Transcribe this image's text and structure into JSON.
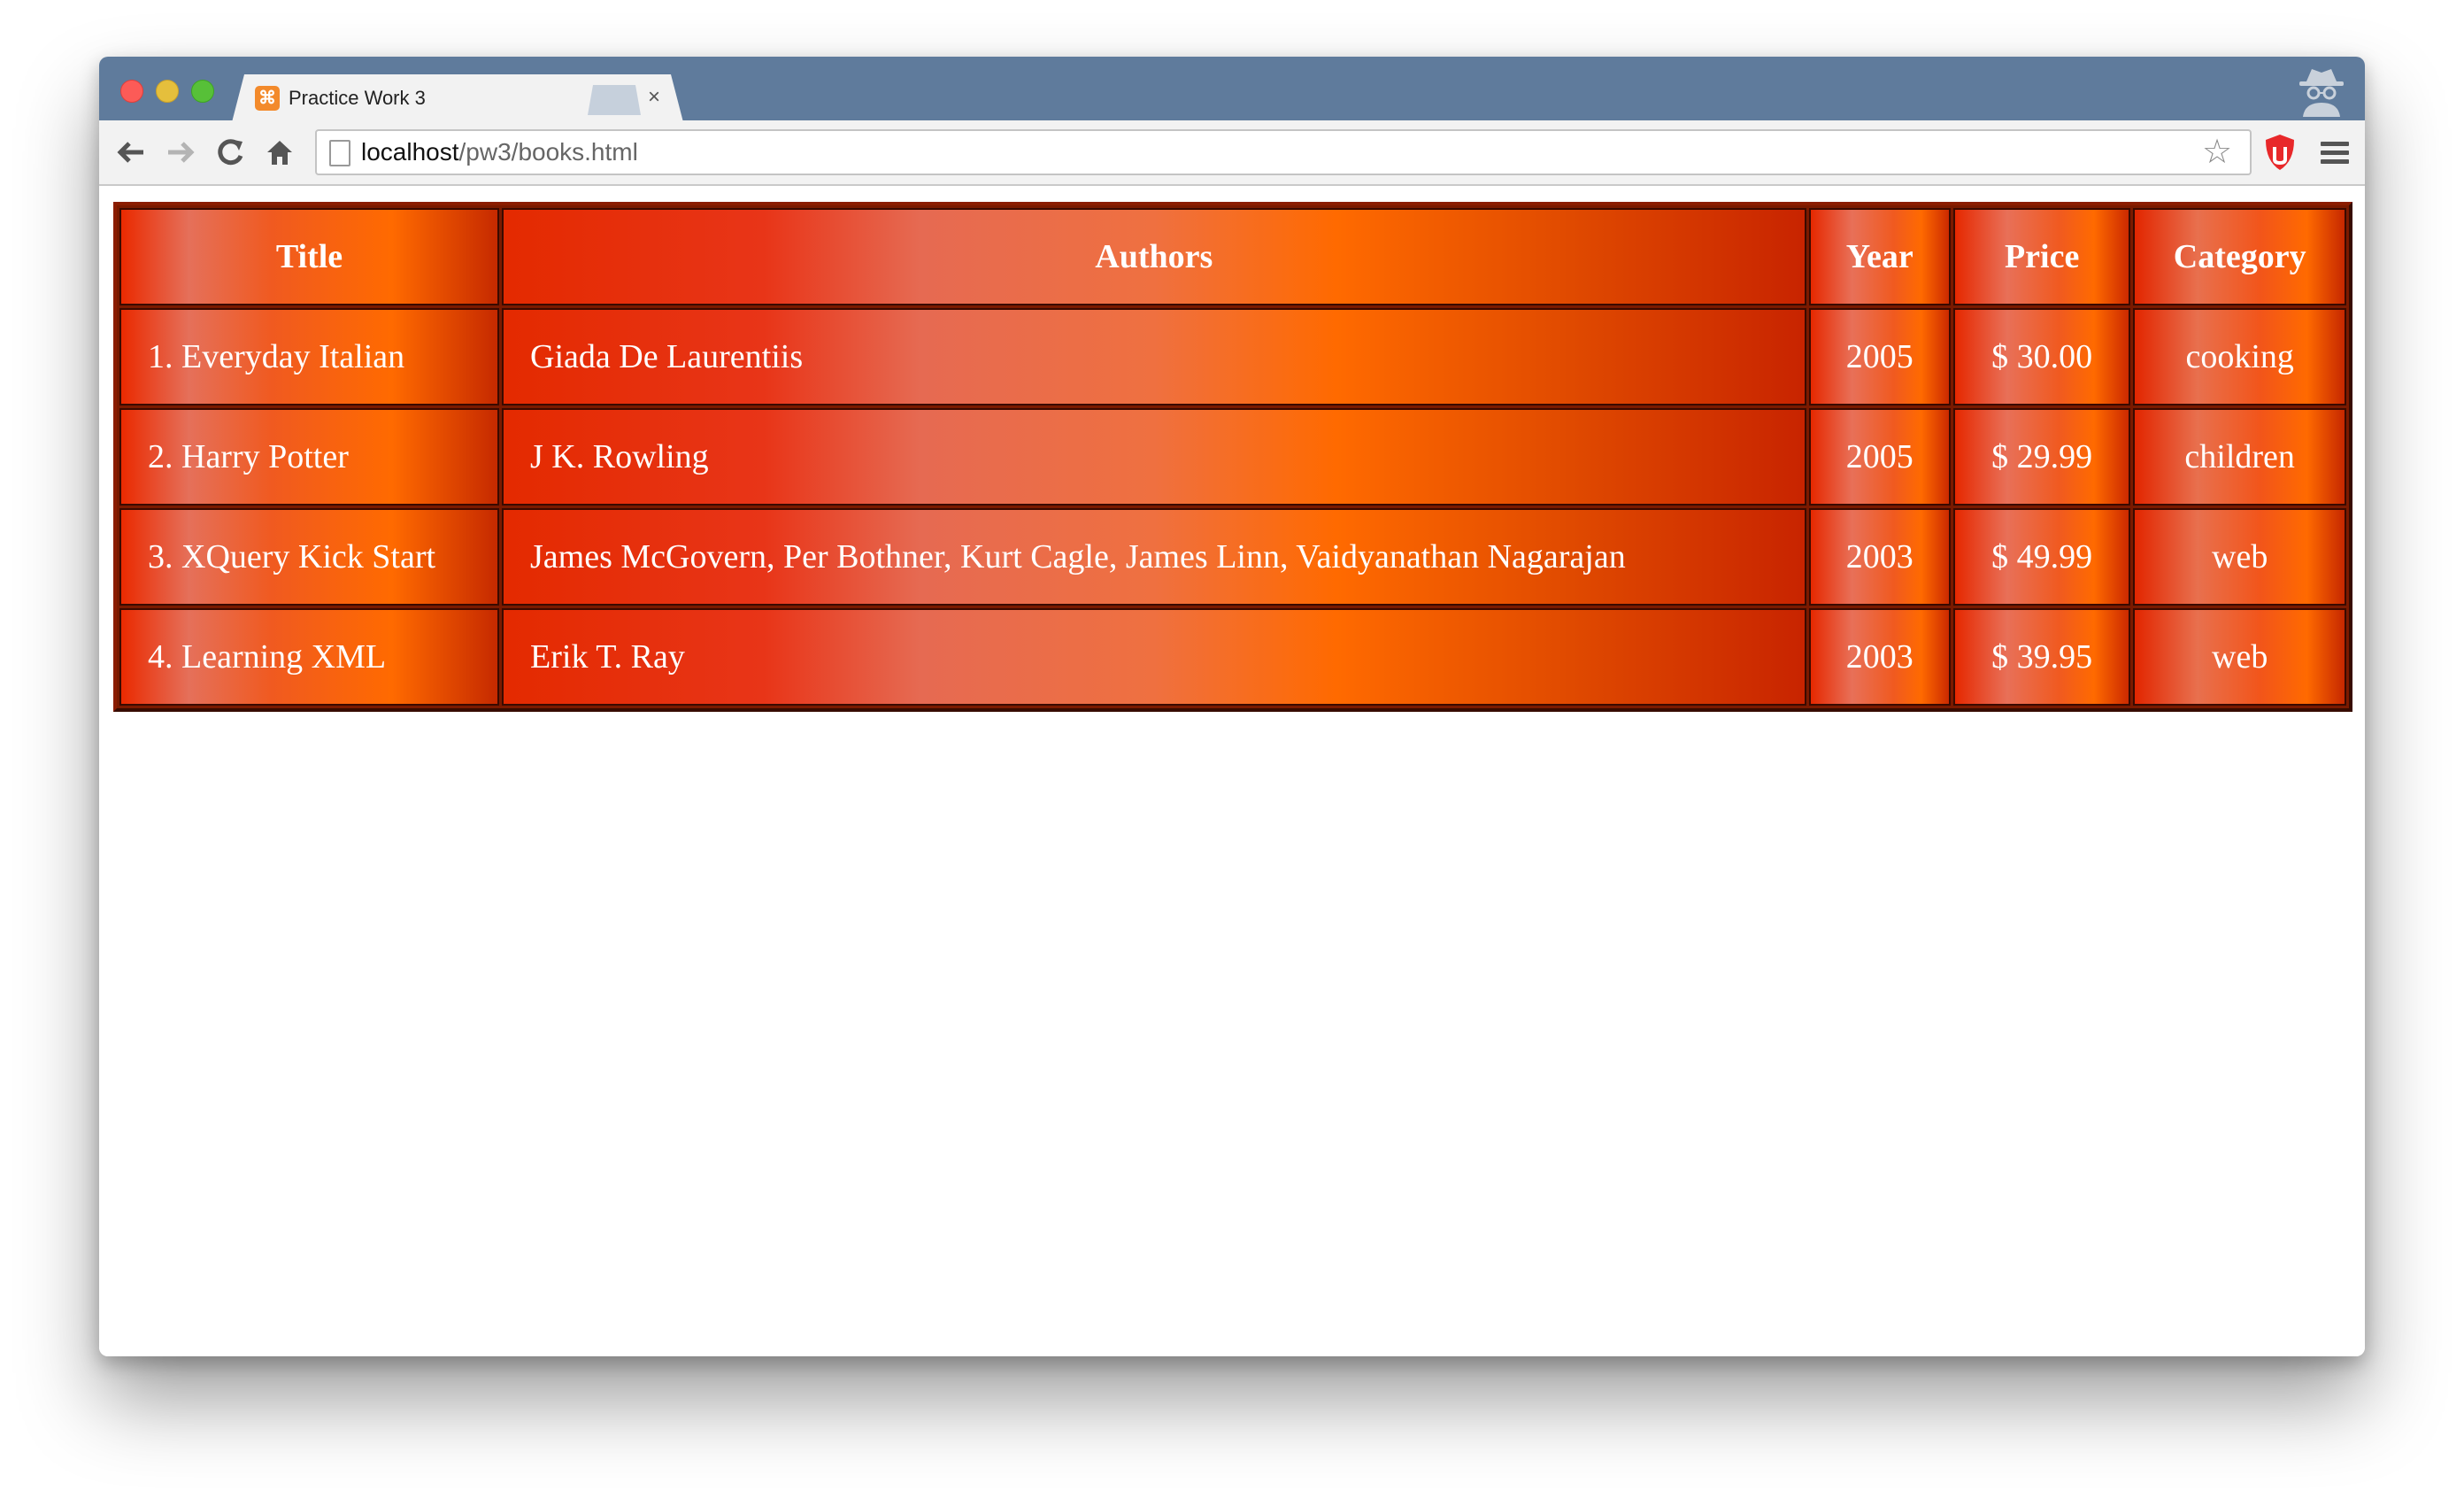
{
  "browser": {
    "tab_title": "Practice Work 3",
    "tab_close": "×",
    "url_host": "localhost",
    "url_path": "/pw3/books.html",
    "icons": [
      "back-icon",
      "forward-icon",
      "reload-icon",
      "home-icon",
      "page-icon",
      "star-icon",
      "ublock-icon",
      "menu-icon",
      "incognito-icon",
      "favicon-icon"
    ]
  },
  "table": {
    "headers": [
      "Title",
      "Authors",
      "Year",
      "Price",
      "Category"
    ],
    "rows": [
      {
        "title": "1. Everyday Italian",
        "authors": "Giada De Laurentiis",
        "year": "2005",
        "price": "$ 30.00",
        "category": "cooking"
      },
      {
        "title": "2. Harry Potter",
        "authors": "J K. Rowling",
        "year": "2005",
        "price": "$ 29.99",
        "category": "children"
      },
      {
        "title": "3. XQuery Kick Start",
        "authors": "James McGovern, Per Bothner, Kurt Cagle, James Linn, Vaidyanathan Nagarajan",
        "year": "2003",
        "price": "$ 49.99",
        "category": "web"
      },
      {
        "title": "4. Learning XML",
        "authors": "Erik T. Ray",
        "year": "2003",
        "price": "$ 39.95",
        "category": "web"
      }
    ]
  },
  "colors": {
    "titlebar": "#5f7b9c",
    "cell_red": "#ea2a00",
    "cell_orange": "#ff6a00"
  }
}
